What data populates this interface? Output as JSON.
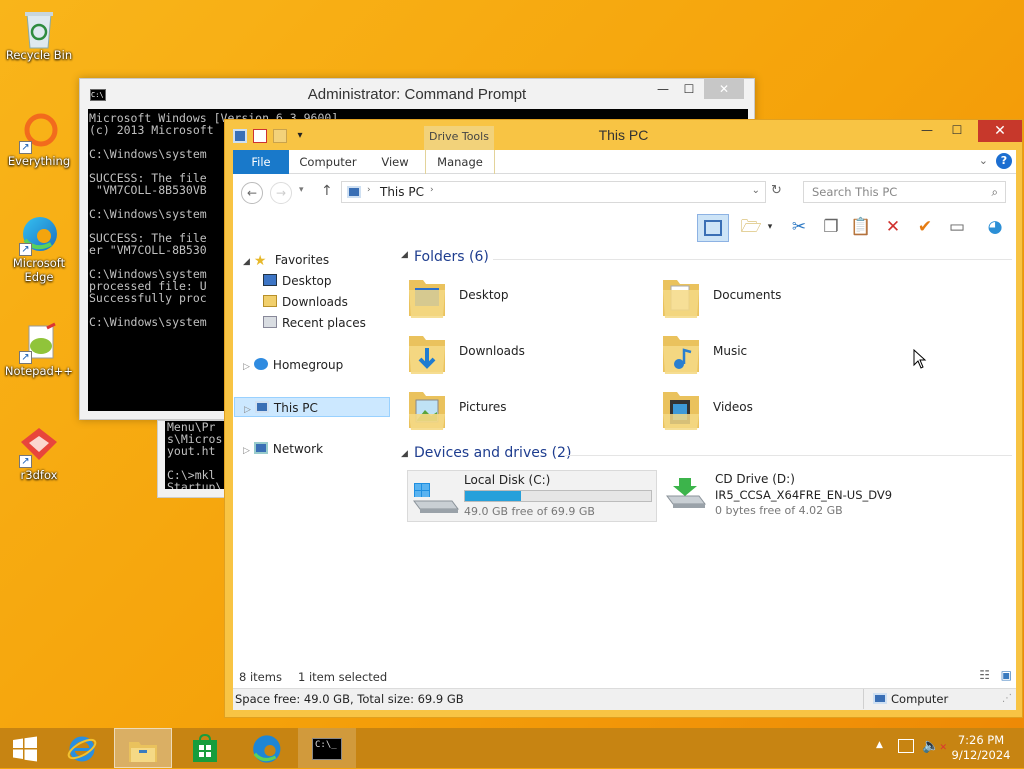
{
  "desktop_icons": [
    {
      "label": "Recycle Bin",
      "icon": "recycle-bin-icon"
    },
    {
      "label": "Everything",
      "icon": "everything-icon"
    },
    {
      "label": "Microsoft Edge",
      "icon": "edge-icon"
    },
    {
      "label": "Notepad++",
      "icon": "notepad-plus-plus-icon"
    },
    {
      "label": "r3dfox",
      "icon": "r3dfox-icon"
    }
  ],
  "cmd": {
    "title": "Administrator: Command Prompt",
    "lines": "Microsoft Windows [Version 6.3.9600]\n(c) 2013 Microsoft\n\nC:\\Windows\\system\n\nSUCCESS: The file\n \"VM7COLL-8B530VB\n\nC:\\Windows\\system\n\nSUCCESS: The file\ner \"VM7COLL-8B530\n\nC:\\Windows\\system\nprocessed file: U\nSuccessfully proc\n\nC:\\Windows\\system",
    "lower_lines": "Menu\\Pr\ns\\Micros\nyout.ht\n\nC:\\>mkl\nStartup\\"
  },
  "explorer": {
    "title": "This PC",
    "contextual_tab": "Drive Tools",
    "tabs": [
      "File",
      "Computer",
      "View",
      "Manage"
    ],
    "address": "This PC",
    "search_placeholder": "Search This PC",
    "nav": {
      "favorites": "Favorites",
      "desktop": "Desktop",
      "downloads": "Downloads",
      "recent": "Recent places",
      "homegroup": "Homegroup",
      "this_pc": "This PC",
      "network": "Network"
    },
    "folders_header": "Folders (6)",
    "folders": [
      "Desktop",
      "Documents",
      "Downloads",
      "Music",
      "Pictures",
      "Videos"
    ],
    "devices_header": "Devices and drives (2)",
    "drives": [
      {
        "name": "Local Disk (C:)",
        "free": "49.0 GB free of 69.9 GB",
        "used_fraction": 0.3
      },
      {
        "name": "CD Drive (D:)",
        "label": "IR5_CCSA_X64FRE_EN-US_DV9",
        "free": "0 bytes free of 4.02 GB"
      }
    ],
    "item_count": "8 items",
    "selected": "1 item selected",
    "status_left": "Space free: 49.0 GB, Total size: 69.9 GB",
    "status_right": "Computer"
  },
  "taskbar": {
    "time": "7:26 PM",
    "date": "9/12/2024"
  }
}
